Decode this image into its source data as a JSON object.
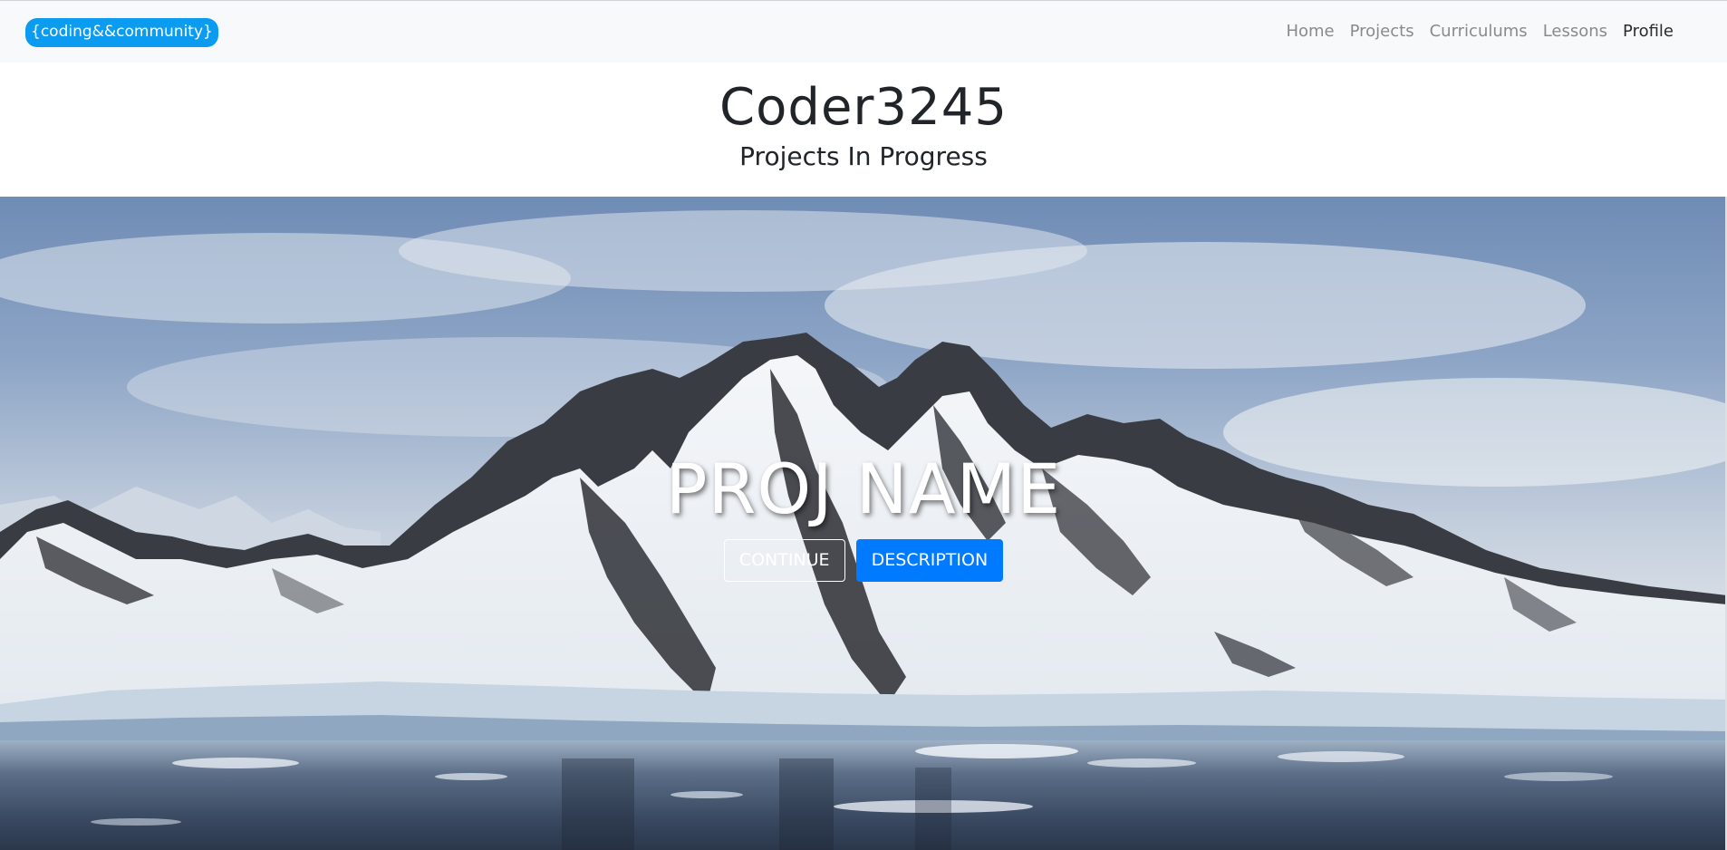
{
  "navbar": {
    "brand": "{coding&&community}",
    "links": [
      {
        "label": "Home"
      },
      {
        "label": "Projects"
      },
      {
        "label": "Curriculums"
      },
      {
        "label": "Lessons"
      },
      {
        "label": "Profile"
      }
    ],
    "active_link": "Profile"
  },
  "header": {
    "username": "Coder3245",
    "section_title": "Projects In Progress"
  },
  "hero": {
    "project_name": "PROJ NAME",
    "continue_label": "CONTINUE",
    "description_label": "DESCRIPTION"
  },
  "colors": {
    "brand_bg": "#0b9bf0",
    "primary_button": "#007bff",
    "navbar_bg": "#f8f9fa",
    "nav_link": "#8a8a8a",
    "nav_link_active": "#2b2b2b"
  }
}
